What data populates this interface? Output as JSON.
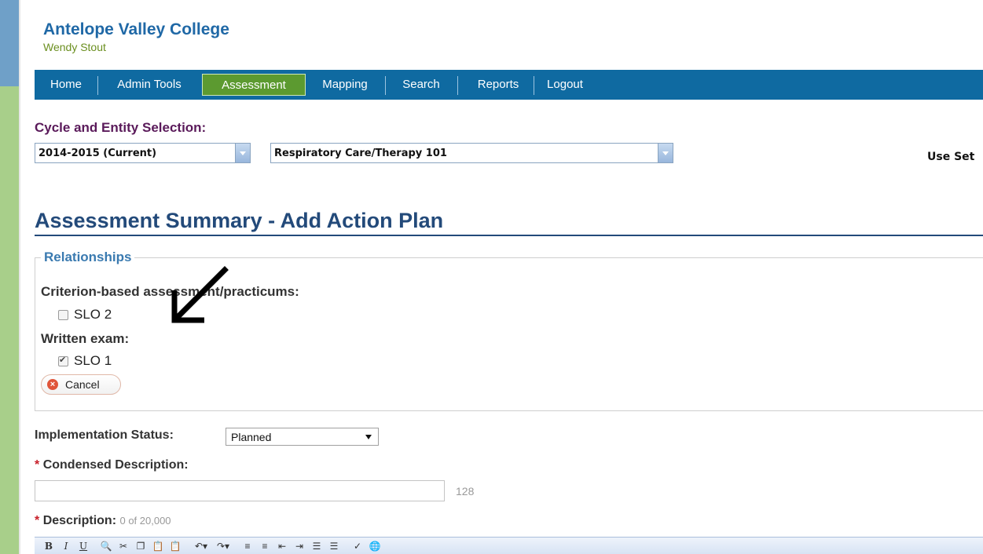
{
  "header": {
    "college": "Antelope Valley College",
    "user": "Wendy Stout"
  },
  "nav": {
    "items": [
      "Home",
      "Admin Tools",
      "Assessment",
      "Mapping",
      "Search",
      "Reports",
      "Logout"
    ],
    "active": "Assessment"
  },
  "cycle": {
    "label": "Cycle and Entity Selection:",
    "cycle_value": "2014-2015  (Current)",
    "entity_value": "Respiratory Care/Therapy 101",
    "use_settings": "Use Set"
  },
  "page": {
    "title": "Assessment Summary - Add Action Plan"
  },
  "relationships": {
    "legend": "Relationships",
    "groups": [
      {
        "label": "Criterion-based assessment/practicums:",
        "item": "SLO 2",
        "checked": false
      },
      {
        "label": "Written exam:",
        "item": "SLO 1",
        "checked": true
      }
    ],
    "cancel_label": "Cancel"
  },
  "form": {
    "impl_label": "Implementation Status:",
    "impl_value": "Planned",
    "required_mark": "*",
    "cond_label": "Condensed Description:",
    "cond_value": "",
    "cond_count": "128",
    "desc_label": "Description:",
    "desc_count": "0 of 20,000"
  },
  "toolbar": {
    "bold": "B",
    "italic": "I",
    "underline": "U"
  },
  "icons": [
    "find-icon",
    "cut-icon",
    "copy-icon",
    "paste-icon",
    "paste-text-icon",
    "undo-icon",
    "redo-icon",
    "align-left-icon",
    "align-center-icon",
    "outdent-icon",
    "indent-icon",
    "ordered-list-icon",
    "bullet-list-icon",
    "spellcheck-icon",
    "link-icon"
  ],
  "colors": {
    "nav_bg": "#0f6aa1",
    "nav_active": "#5c9a30",
    "title": "#234a7a",
    "college": "#1f68a6"
  }
}
